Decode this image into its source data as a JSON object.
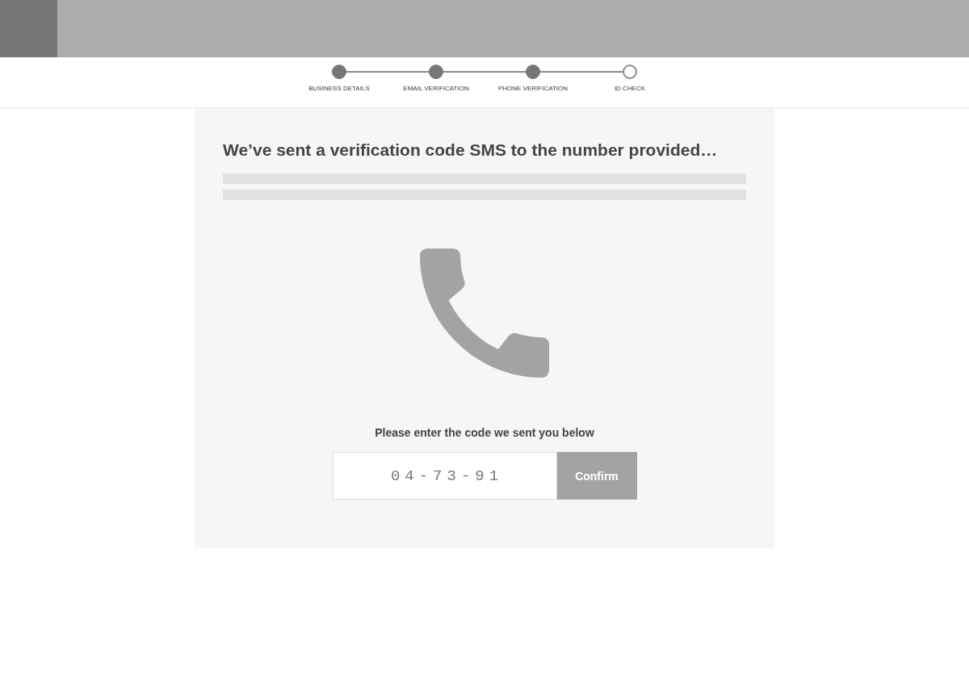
{
  "steps": [
    {
      "label": "BUSINESS DETAILS",
      "completed": true
    },
    {
      "label": "EMAIL VERIFICATION",
      "completed": true
    },
    {
      "label": "PHONE VERIFICATION",
      "completed": true
    },
    {
      "label": "ID CHECK",
      "completed": false
    }
  ],
  "card": {
    "title": "We’ve sent a verification code SMS to the number provided…",
    "placeholder_bars": [
      {
        "kind": "text_line"
      },
      {
        "kind": "text_line"
      }
    ],
    "instruction": "Please enter the code we sent you below",
    "code_field": {
      "value": "04-73-91"
    },
    "confirm_button": "Confirm"
  }
}
